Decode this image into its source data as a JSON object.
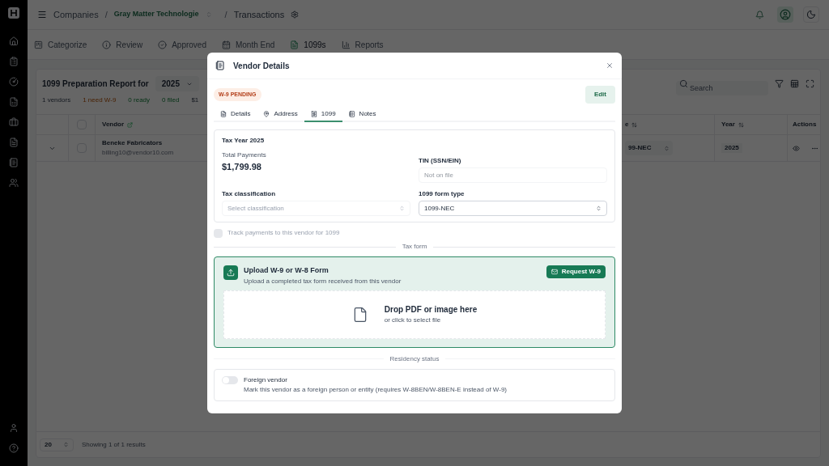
{
  "breadcrumb": {
    "items": [
      "Companies",
      "Gray Matter Technologie",
      "Transactions"
    ],
    "separators": [
      "/",
      "/"
    ]
  },
  "nav_tabs": [
    {
      "label": "Categorize",
      "selected": false
    },
    {
      "label": "Review",
      "selected": false
    },
    {
      "label": "Approved",
      "selected": false
    },
    {
      "label": "Month End",
      "selected": false
    },
    {
      "label": "1099s",
      "selected": true
    },
    {
      "label": "Reports",
      "selected": false
    }
  ],
  "report": {
    "title": "1099 Preparation Report for",
    "year": "2025",
    "stats": [
      {
        "text": "1 vendors",
        "kind": "neutral"
      },
      {
        "text": "1 need W-9",
        "kind": "warning"
      },
      {
        "text": "0 ready",
        "kind": "success"
      },
      {
        "text": "0 filed",
        "kind": "success"
      },
      {
        "text": "$1",
        "kind": "neutral"
      }
    ]
  },
  "search": {
    "placeholder": "Search"
  },
  "table": {
    "columns": [
      "Vendor",
      "e",
      "Year",
      "Actions"
    ],
    "all_checked": false,
    "rows": [
      {
        "vendor": "Beneke Fabricators",
        "email": "billing10@vendor10.com",
        "form_type": "99-NEC",
        "year": "2025",
        "expanded": false,
        "checked": false
      }
    ]
  },
  "pagination": {
    "page_size": "20",
    "summary": "Showing 1 of 1 results"
  },
  "modal": {
    "title": "Vendor Details",
    "badge": "W-9 PENDING",
    "edit": "Edit",
    "tabs": [
      {
        "label": "Details",
        "selected": false
      },
      {
        "label": "Address",
        "selected": false
      },
      {
        "label": "1099",
        "selected": true
      },
      {
        "label": "Notes",
        "selected": false
      }
    ],
    "tax_year": "Tax Year 2025",
    "total_label": "Total Payments",
    "total": "$1,799.98",
    "tin": {
      "label": "TIN (SSN/EIN)",
      "placeholder": "Not on file"
    },
    "classification": {
      "label": "Tax classification",
      "placeholder": "Select classification"
    },
    "form_type": {
      "label": "1099 form type",
      "value": "1099-NEC"
    },
    "track": {
      "label": "Track payments to this vendor for 1099",
      "checked": false,
      "disabled": true
    },
    "tax_form_divider": "Tax form",
    "upload": {
      "title": "Upload W-9 or W-8 Form",
      "subtitle": "Upload a completed tax form received from this vendor",
      "request": "Request W-9",
      "drop_title": "Drop PDF or image here",
      "drop_hint": "or click to select file"
    },
    "residency_divider": "Residency status",
    "foreign": {
      "label": "Foreign vendor",
      "description": "Mark this vendor as a foreign person or entity (requires W-8BEN/W-8BEN-E instead of W-9)",
      "on": false
    }
  }
}
